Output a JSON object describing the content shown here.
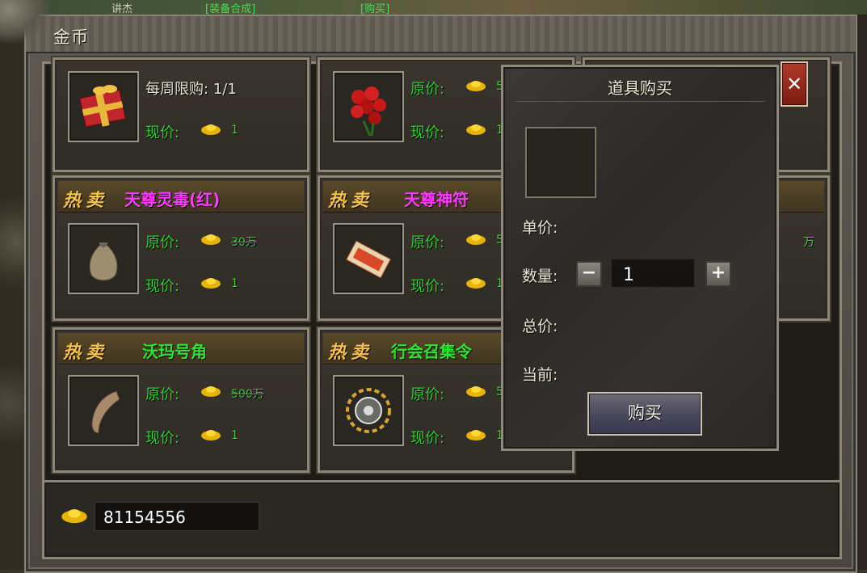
{
  "window": {
    "title": "金币",
    "close_symbol": "✕"
  },
  "top_strip": {
    "texts": [
      "讲杰",
      "[装备合成]",
      "[购买]"
    ]
  },
  "labels": {
    "hot": "热卖",
    "orig_price": "原价:",
    "cur_price": "现价:"
  },
  "cards": [
    {
      "name": "",
      "limit_label": "每周限购:",
      "limit_value": "1/1",
      "current_value": "1"
    },
    {
      "name": "",
      "orig_value": "5",
      "current_value": "1"
    },
    {
      "name": "天尊灵毒(红)",
      "name_color": "#ff3cff",
      "orig_value": "30万",
      "current_value": "1"
    },
    {
      "name": "天尊神符",
      "name_color": "#ff3cff",
      "orig_value": "5",
      "current_value": "1"
    },
    {
      "name": "沃玛号角",
      "name_color": "#2ee62e",
      "orig_value": "500万",
      "current_value": "1"
    },
    {
      "name": "行会召集令",
      "name_color": "#2ee62e",
      "orig_value": "5",
      "current_value": "1"
    }
  ],
  "partial_card": {
    "orig_tail": "万"
  },
  "gold": {
    "amount": "81154556"
  },
  "dialog": {
    "title": "道具购买",
    "unit_price_label": "单价:",
    "quantity_label": "数量:",
    "quantity_value": "1",
    "minus": "−",
    "plus": "+",
    "total_label": "总价:",
    "current_label": "当前:",
    "buy_label": "购买"
  },
  "colors": {
    "price_green": "#2ed12e",
    "hot_gold": "#f2c24a",
    "magenta": "#ff3cff"
  }
}
